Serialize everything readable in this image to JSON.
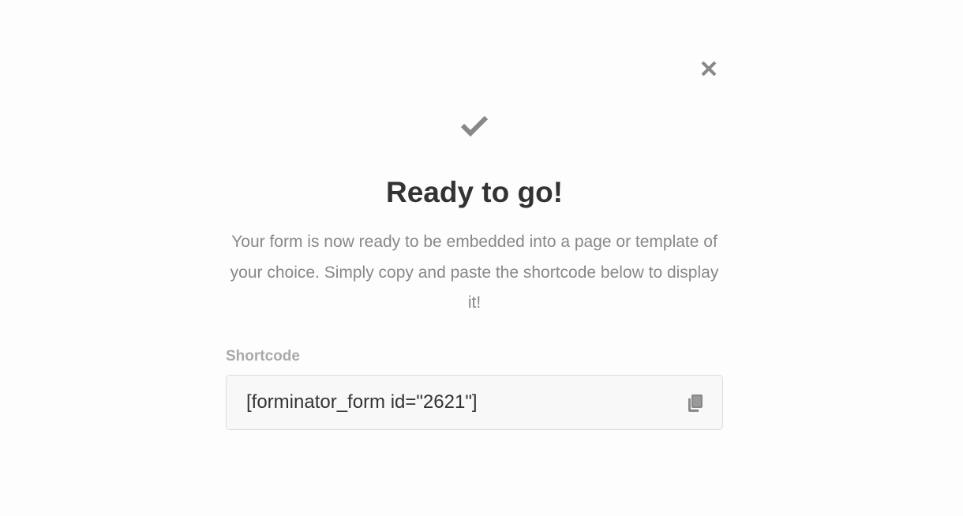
{
  "modal": {
    "title": "Ready to go!",
    "description": "Your form is now ready to be embedded into a page or template of your choice. Simply copy and paste the shortcode below to display it!",
    "shortcode_label": "Shortcode",
    "shortcode_value": "[forminator_form id=\"2621\"]",
    "icons": {
      "close": "close-icon",
      "success": "checkmark-icon",
      "copy": "copy-icon"
    },
    "colors": {
      "icon": "#888888",
      "title": "#333333",
      "text": "#888888",
      "label": "#aaaaaa",
      "field_bg": "#f8f8f8",
      "field_border": "#dddddd"
    }
  }
}
